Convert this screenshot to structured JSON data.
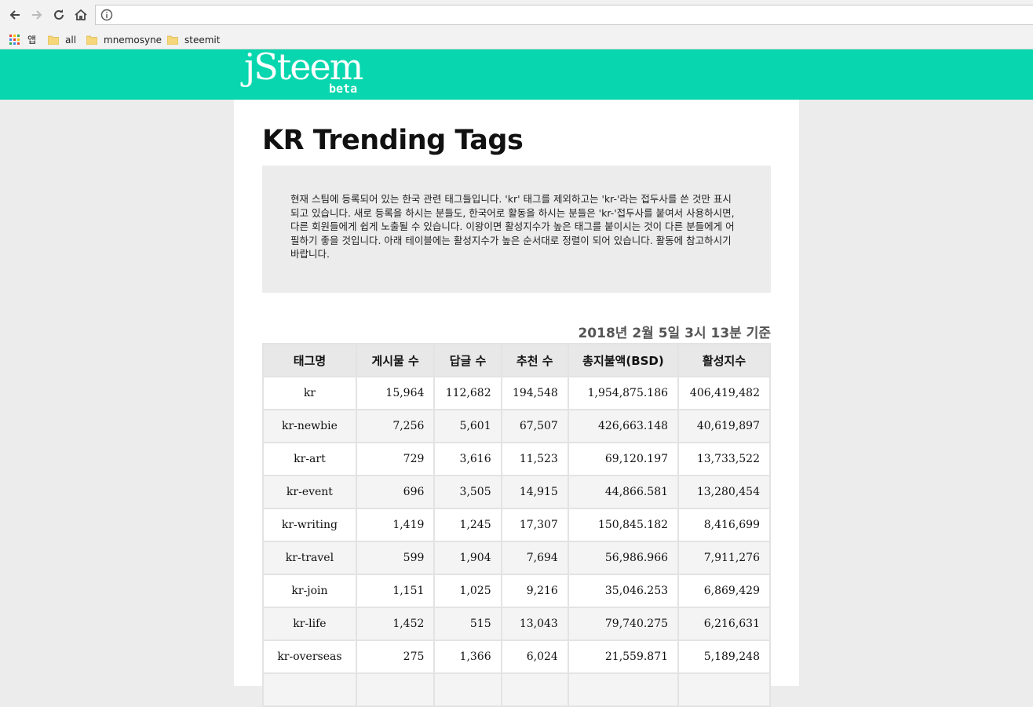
{
  "browser": {
    "bookmarks": [
      {
        "label": "앱",
        "icon": "apps-grid-icon"
      },
      {
        "label": "all",
        "icon": "folder-icon"
      },
      {
        "label": "mnemosyne",
        "icon": "folder-icon"
      },
      {
        "label": "steemit",
        "icon": "folder-icon"
      }
    ]
  },
  "site": {
    "logo_main": "jSteem",
    "logo_sub": "beta",
    "header_color": "#07d6ae"
  },
  "page": {
    "title": "KR Trending Tags",
    "intro": "현재 스팀에 등록되어 있는 한국 관련 태그들입니다. 'kr' 태그를 제외하고는 'kr-'라는 접두사를 쓴 것만 표시되고 있습니다. 새로 등록을 하시는 분들도, 한국어로 활동을 하시는 분들은 'kr-'접두사를 붙여서 사용하시면, 다른 회원들에게 쉽게 노출될 수 있습니다. 이왕이면 활성지수가 높은 태그를 붙이시는 것이 다른 분들에게 어필하기 좋을 것입니다. 아래 테이블에는 활성지수가 높은 순서대로 정렬이 되어 있습니다. 활동에 참고하시기 바랍니다.",
    "timestamp": "2018년 2월 5일 3시 13분 기준"
  },
  "table": {
    "headers": [
      "태그명",
      "게시물 수",
      "답글 수",
      "추천 수",
      "총지불액(BSD)",
      "활성지수"
    ],
    "rows": [
      [
        "kr",
        "15,964",
        "112,682",
        "194,548",
        "1,954,875.186",
        "406,419,482"
      ],
      [
        "kr-newbie",
        "7,256",
        "5,601",
        "67,507",
        "426,663.148",
        "40,619,897"
      ],
      [
        "kr-art",
        "729",
        "3,616",
        "11,523",
        "69,120.197",
        "13,733,522"
      ],
      [
        "kr-event",
        "696",
        "3,505",
        "14,915",
        "44,866.581",
        "13,280,454"
      ],
      [
        "kr-writing",
        "1,419",
        "1,245",
        "17,307",
        "150,845.182",
        "8,416,699"
      ],
      [
        "kr-travel",
        "599",
        "1,904",
        "7,694",
        "56,986.966",
        "7,911,276"
      ],
      [
        "kr-join",
        "1,151",
        "1,025",
        "9,216",
        "35,046.253",
        "6,869,429"
      ],
      [
        "kr-life",
        "1,452",
        "515",
        "13,043",
        "79,740.275",
        "6,216,631"
      ],
      [
        "kr-overseas",
        "275",
        "1,366",
        "6,024",
        "21,559.871",
        "5,189,248"
      ]
    ]
  }
}
